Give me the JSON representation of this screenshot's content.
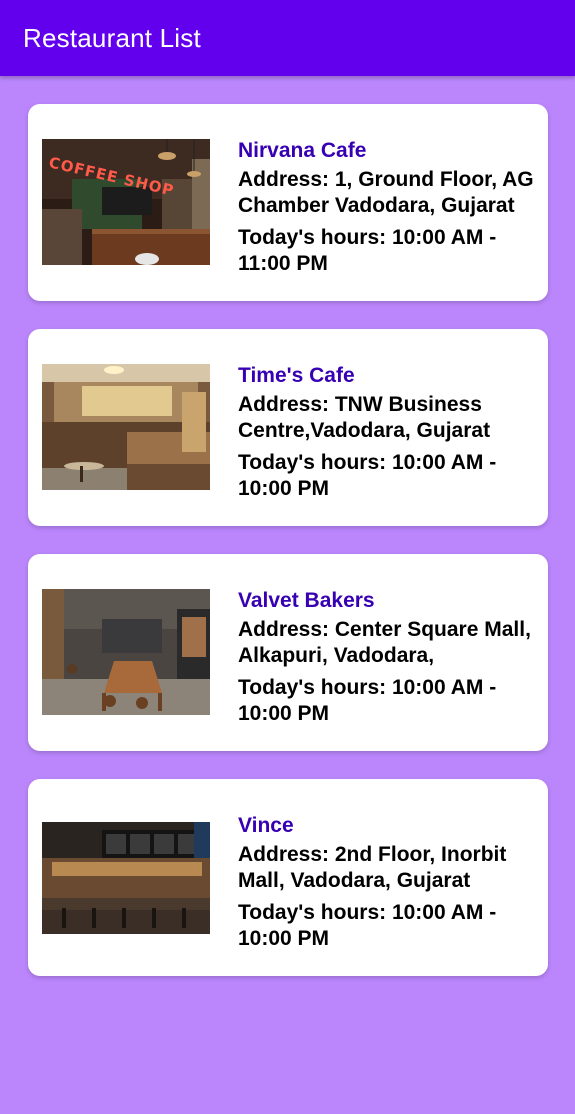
{
  "app_bar": {
    "title": "Restaurant List",
    "color": "#6200EE"
  },
  "background_color": "#BB86FC",
  "restaurants": [
    {
      "name": "Nirvana Cafe",
      "address": "Address: 1, Ground Floor, AG Chamber Vadodara, Gujarat",
      "hours": "Today's hours: 10:00 AM - 11:00 PM",
      "photo_sign": "COFFEE SHOP"
    },
    {
      "name": "Time's Cafe",
      "address": "Address: TNW Business Centre,Vadodara, Gujarat",
      "hours": "Today's hours: 10:00 AM - 10:00 PM"
    },
    {
      "name": "Valvet Bakers",
      "address": "Address: Center Square Mall, Alkapuri, Vadodara,",
      "hours": "Today's hours: 10:00 AM - 10:00 PM"
    },
    {
      "name": "Vince",
      "address": "Address: 2nd Floor, Inorbit Mall, Vadodara, Gujarat",
      "hours": "Today's hours: 10:00 AM - 10:00 PM"
    }
  ]
}
